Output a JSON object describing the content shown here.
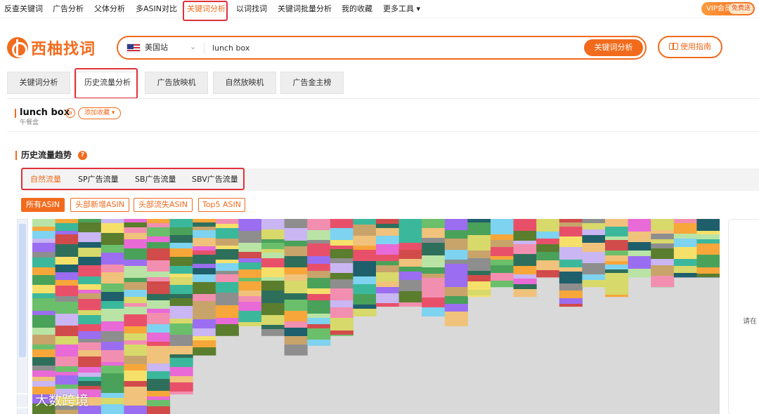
{
  "nav": {
    "items": [
      "反查关键词",
      "广告分析",
      "父体分析",
      "多ASIN对比",
      "关键词分析",
      "以词找词",
      "关键词批量分析",
      "我的收藏",
      "更多工具"
    ],
    "active_index": 4,
    "more_chevron": "▾"
  },
  "vip": {
    "label": "VIP会员",
    "free": "免费送"
  },
  "header": {
    "logo_text": "西柚找词",
    "site_label": "美国站",
    "site_chevron": "⌄",
    "search_value": "lunch box",
    "search_button": "关键词分析",
    "guide_button": "使用指南"
  },
  "tabs": {
    "items": [
      "关键词分析",
      "历史流量分析",
      "广告放映机",
      "自然放映机",
      "广告金主榜"
    ],
    "active_index": 1
  },
  "keyword": {
    "title": "lunch box",
    "badge": "a",
    "favorite": "添加收藏 ▾",
    "translation": "午餐盒"
  },
  "section": {
    "title": "历史流量趋势",
    "help": "?",
    "traffic_tabs": [
      "自然流量",
      "SP广告流量",
      "SB广告流量",
      "SBV广告流量"
    ],
    "traffic_active": 0,
    "filters": [
      "所有ASIN",
      "头部新增ASIN",
      "头部流失ASIN",
      "Top5 ASIN"
    ],
    "filter_active": 0
  },
  "side_panel": {
    "text": "请在"
  },
  "watermark": {
    "text": "大数跨境"
  },
  "chart_data": {
    "type": "area",
    "stacking": "stacked",
    "columns": 30,
    "column_fill_fraction": [
      1.0,
      1.0,
      1.0,
      1.0,
      1.0,
      1.0,
      0.9,
      0.7,
      0.6,
      0.55,
      0.6,
      0.7,
      0.65,
      0.6,
      0.5,
      0.45,
      0.45,
      0.5,
      0.55,
      0.4,
      0.35,
      0.4,
      0.3,
      0.45,
      0.35,
      0.4,
      0.3,
      0.35,
      0.3,
      0.3
    ],
    "palette": [
      "#d7d96a",
      "#3bb89b",
      "#e8506a",
      "#4aa15a",
      "#f7a63a",
      "#c8a46b",
      "#2e6f5b",
      "#e86ad6",
      "#9b6df0",
      "#f5e16a",
      "#7dd3f0",
      "#b9e4a6",
      "#d14b4b",
      "#5a7d2e",
      "#f28fb0",
      "#8e8e8e",
      "#1e5f6b",
      "#c9b6f2",
      "#f0c27b",
      "#6bbf6b"
    ],
    "grid": false,
    "background": "#d9d9d9"
  }
}
